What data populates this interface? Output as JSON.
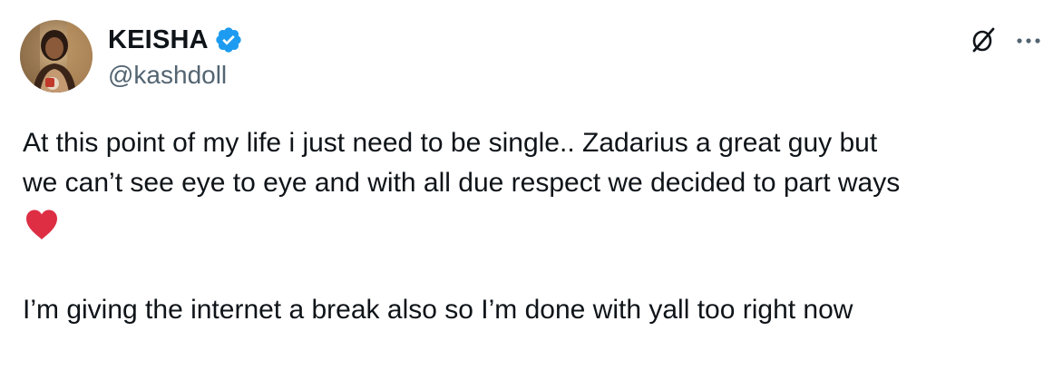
{
  "author": {
    "display_name": "KEISHA",
    "handle": "@kashdoll",
    "verified": true,
    "avatar_icon": "avatar-photo"
  },
  "actions": {
    "grok_icon": "grok-icon",
    "more_icon": "more-icon"
  },
  "tweet": {
    "line1": "At this point of my life i just need to be single.. Zadarius a great guy but",
    "line2": "we can’t see eye to eye and with all due respect we decided to part ways",
    "emoji": "heart-emoji",
    "paragraph2": "I’m giving the internet a break also so I’m done with yall too right now"
  },
  "colors": {
    "text": "#0f1419",
    "secondary": "#536471",
    "verified_blue": "#1d9bf0",
    "heart_red": "#dd2e44"
  }
}
